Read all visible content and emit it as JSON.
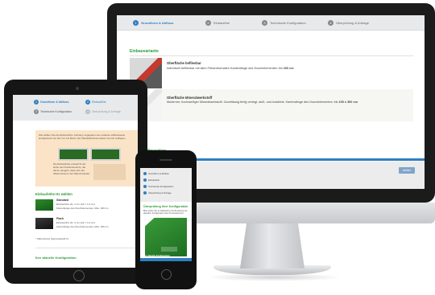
{
  "desktop": {
    "steps": [
      {
        "num": "1",
        "label": "Grundform & Abfluss",
        "active": true
      },
      {
        "num": "2",
        "label": "Einbaulöhe"
      },
      {
        "num": "3",
        "label": "Technische Konfiguration"
      },
      {
        "num": "4",
        "label": "Überprüfung & Anfrage"
      }
    ],
    "section_title": "Einbauvariante",
    "option1": {
      "title": "Oberfläche befliesbar",
      "desc": "Individuell befliesbar mit allen Fliesenformaten Kantenlänge des Duschelementes: bis",
      "value": "200 cm"
    },
    "option2": {
      "title": "Oberfläche Mineralwerkstoff",
      "desc": "Moderner, hochwertiger Mineralwerkstoff. Zuverlässig fertig verlegt, stoß- und kratzfest. Kantenlänge des Duschelementes: bis",
      "value": "150 x 300 cm"
    },
    "config_heading": "figuration",
    "button_label": "weiter"
  },
  "tablet": {
    "steps": [
      {
        "num": "1",
        "label": "Grundform & Abfluss",
        "blue": true
      },
      {
        "num": "2",
        "label": "Einbaulöhe",
        "blue": true
      },
      {
        "num": "3",
        "label": "Technische Konfiguration"
      },
      {
        "num": "4",
        "label": "Überprüfung & Anfrage"
      }
    ],
    "hint_text": "Wie wählen Sie die Einbauhöhe. Achtung: angegeben den anderen Abflusswerte konfigurieren sie hier 'fur' ein Bund. Der Wandabschluss lassen sie hier aufliegen.",
    "hint_text2": "Die Einbauhöhe entspricht der Höhe des Duschelements, die davon ausgeht, dass sich der Ablauf direkt in der Wand befindet.",
    "section_title": "Einbauhöhe H1 wählen",
    "option1": {
      "title": "Standard",
      "line1": "Einbauhöhe H1: 4 cm (H2 = 1,0 cm)",
      "line2": "Kantenlänge des Duschelementes: Max. 300 cm"
    },
    "option2": {
      "title": "Flach",
      "line1": "Einbauhöhe H1: 3 cm (H2 = 1,0 cm)",
      "line2": "Kantenlänge des Duschelementes: Max. 300 cm"
    },
    "footnote": "* Abbrechung Sperrauswahl bz",
    "config_heading": "Ihre aktuelle Konfiguration"
  },
  "phone": {
    "steps": [
      {
        "label": "Grundform & Abfluss"
      },
      {
        "label": "Einbaulöhe"
      },
      {
        "label": "Technische Konfiguration"
      },
      {
        "label": "Überprüfung & Anfrage"
      }
    ],
    "title": "Überprüfung Ihrer Konfiguration",
    "desc": "Bitte prüfen Sie an Maßnahme die Bestellung der aktuellen Konfiguration Ihres Duschelements.",
    "bottom_heading": "Ihre aktuelle Konfiguration"
  },
  "colors": {
    "accent_blue": "#2f7fc1",
    "accent_green": "#2e9a3a",
    "hint_bg": "#fbe3c7"
  }
}
